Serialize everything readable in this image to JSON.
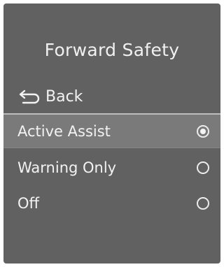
{
  "screen": {
    "title": "Forward Safety",
    "back": {
      "label": "Back",
      "icon": "back-arrow-icon"
    },
    "options": [
      {
        "label": "Active Assist",
        "selected": true
      },
      {
        "label": "Warning Only",
        "selected": false
      },
      {
        "label": "Off",
        "selected": false
      }
    ]
  },
  "colors": {
    "background": "#616161",
    "highlight": "#7a7a7a",
    "text": "#f2f2f2"
  }
}
